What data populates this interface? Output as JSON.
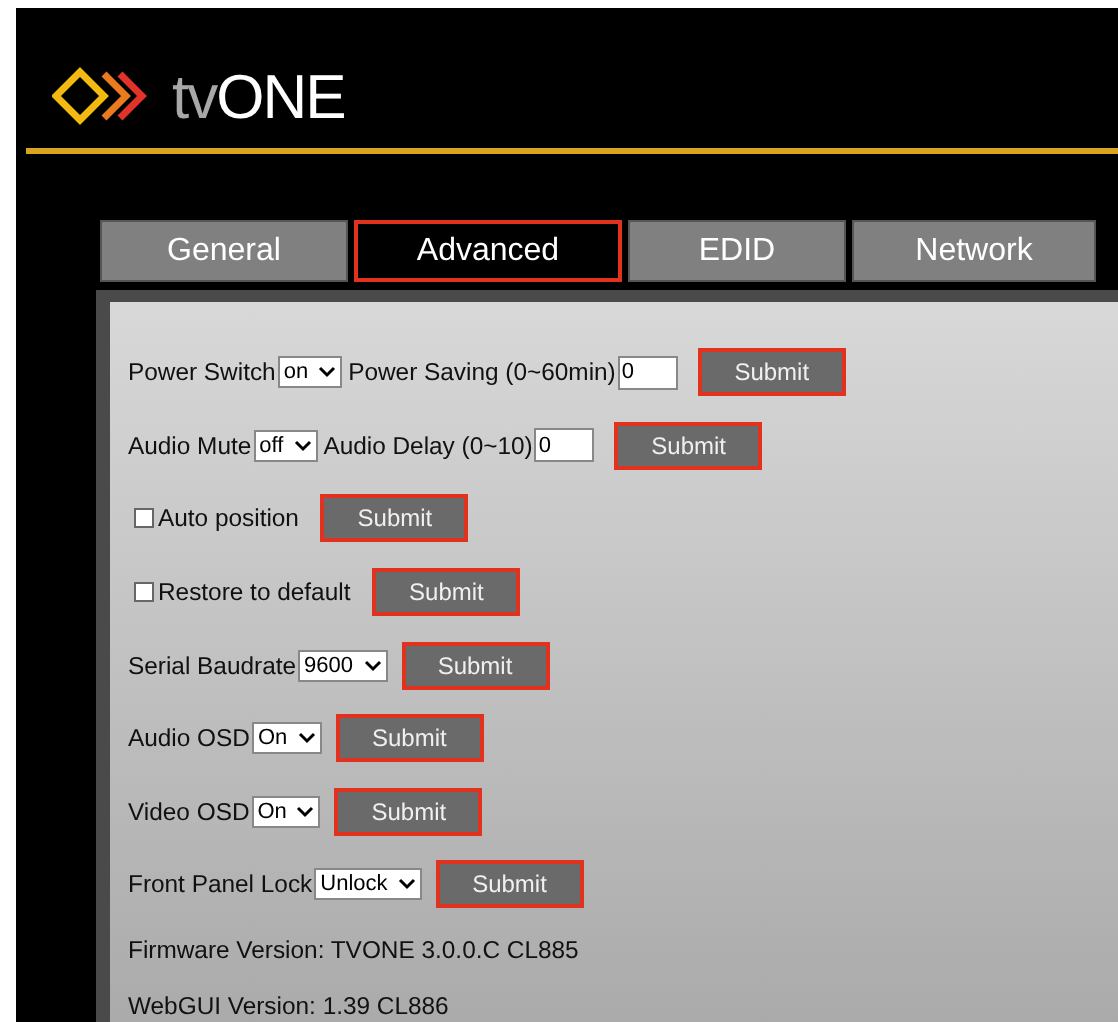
{
  "logo": {
    "light": "tv",
    "bold": "ONE"
  },
  "tabs": [
    {
      "label": "General",
      "selected": false
    },
    {
      "label": "Advanced",
      "selected": true
    },
    {
      "label": "EDID",
      "selected": false
    },
    {
      "label": "Network",
      "selected": false
    }
  ],
  "rows": [
    [
      {
        "kind": "label",
        "text": "Power Switch"
      },
      {
        "kind": "select",
        "value": "on"
      },
      {
        "kind": "label",
        "text": "Power Saving (0~60min)"
      },
      {
        "kind": "input",
        "value": "0"
      },
      {
        "kind": "submit",
        "label": "Submit"
      }
    ],
    [
      {
        "kind": "label",
        "text": "Audio Mute"
      },
      {
        "kind": "select",
        "value": "off"
      },
      {
        "kind": "label",
        "text": "Audio Delay (0~10)"
      },
      {
        "kind": "input",
        "value": "0"
      },
      {
        "kind": "submit",
        "label": "Submit"
      }
    ],
    [
      {
        "kind": "checkbox",
        "label": "Auto position",
        "checked": false
      },
      {
        "kind": "submit",
        "label": "Submit"
      }
    ],
    [
      {
        "kind": "checkbox",
        "label": "Restore to default",
        "checked": false
      },
      {
        "kind": "submit",
        "label": "Submit"
      }
    ],
    [
      {
        "kind": "label",
        "text": "Serial Baudrate"
      },
      {
        "kind": "select",
        "value": "9600"
      },
      {
        "kind": "submit",
        "label": "Submit"
      }
    ],
    [
      {
        "kind": "label",
        "text": "Audio OSD"
      },
      {
        "kind": "select",
        "value": "On"
      },
      {
        "kind": "submit",
        "label": "Submit"
      }
    ],
    [
      {
        "kind": "label",
        "text": "Video OSD"
      },
      {
        "kind": "select",
        "value": "On"
      },
      {
        "kind": "submit",
        "label": "Submit"
      }
    ],
    [
      {
        "kind": "label",
        "text": "Front Panel Lock"
      },
      {
        "kind": "select",
        "value": "Unlock"
      },
      {
        "kind": "submit",
        "label": "Submit"
      }
    ],
    [
      {
        "kind": "label",
        "text": "Firmware Version: TVONE 3.0.0.C CL885"
      }
    ],
    [
      {
        "kind": "label",
        "text": "WebGUI Version: 1.39 CL886"
      }
    ]
  ]
}
